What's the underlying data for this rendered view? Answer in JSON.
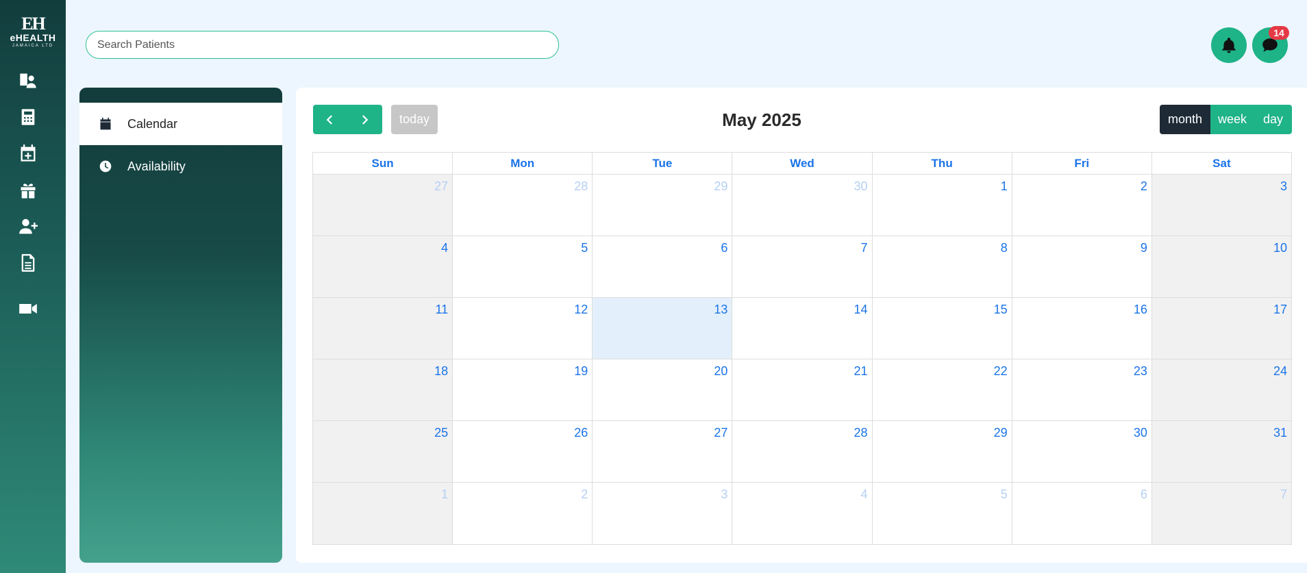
{
  "logo": {
    "monogram": "EH",
    "brand": "eHEALTH",
    "subtitle": "JAMAICA LTD"
  },
  "rail": {
    "icons": [
      "patient-profile-icon",
      "calculator-icon",
      "calendar-plus-icon",
      "gift-icon",
      "user-plus-icon",
      "document-icon",
      "video-camera-icon"
    ]
  },
  "header": {
    "search_placeholder": "Search Patients",
    "notifications_icon": "bell-icon",
    "messages_icon": "chat-bubble-icon",
    "messages_badge": "14"
  },
  "sidemenu": {
    "items": [
      {
        "label": "Calendar",
        "icon": "calendar-icon",
        "active": true
      },
      {
        "label": "Availability",
        "icon": "clock-icon",
        "active": false
      }
    ]
  },
  "calendar": {
    "title": "May 2025",
    "today_label": "today",
    "prev_icon": "chevron-left-icon",
    "next_icon": "chevron-right-icon",
    "views": [
      {
        "label": "month",
        "active": true
      },
      {
        "label": "week",
        "active": false
      },
      {
        "label": "day",
        "active": false
      }
    ],
    "weekdays": [
      "Sun",
      "Mon",
      "Tue",
      "Wed",
      "Thu",
      "Fri",
      "Sat"
    ],
    "weeks": [
      [
        {
          "d": "27",
          "o": true
        },
        {
          "d": "28",
          "o": true
        },
        {
          "d": "29",
          "o": true
        },
        {
          "d": "30",
          "o": true
        },
        {
          "d": "1"
        },
        {
          "d": "2"
        },
        {
          "d": "3"
        }
      ],
      [
        {
          "d": "4"
        },
        {
          "d": "5"
        },
        {
          "d": "6"
        },
        {
          "d": "7"
        },
        {
          "d": "8"
        },
        {
          "d": "9"
        },
        {
          "d": "10"
        }
      ],
      [
        {
          "d": "11"
        },
        {
          "d": "12"
        },
        {
          "d": "13",
          "t": true
        },
        {
          "d": "14"
        },
        {
          "d": "15"
        },
        {
          "d": "16"
        },
        {
          "d": "17"
        }
      ],
      [
        {
          "d": "18"
        },
        {
          "d": "19"
        },
        {
          "d": "20"
        },
        {
          "d": "21"
        },
        {
          "d": "22"
        },
        {
          "d": "23"
        },
        {
          "d": "24"
        }
      ],
      [
        {
          "d": "25"
        },
        {
          "d": "26"
        },
        {
          "d": "27"
        },
        {
          "d": "28"
        },
        {
          "d": "29"
        },
        {
          "d": "30"
        },
        {
          "d": "31"
        }
      ],
      [
        {
          "d": "1",
          "o": true
        },
        {
          "d": "2",
          "o": true
        },
        {
          "d": "3",
          "o": true
        },
        {
          "d": "4",
          "o": true
        },
        {
          "d": "5",
          "o": true
        },
        {
          "d": "6",
          "o": true
        },
        {
          "d": "7",
          "o": true
        }
      ]
    ]
  },
  "colors": {
    "accent": "#1fb388",
    "dark": "#1e2a36",
    "link_blue": "#1a73e8",
    "badge_red": "#e53945"
  }
}
